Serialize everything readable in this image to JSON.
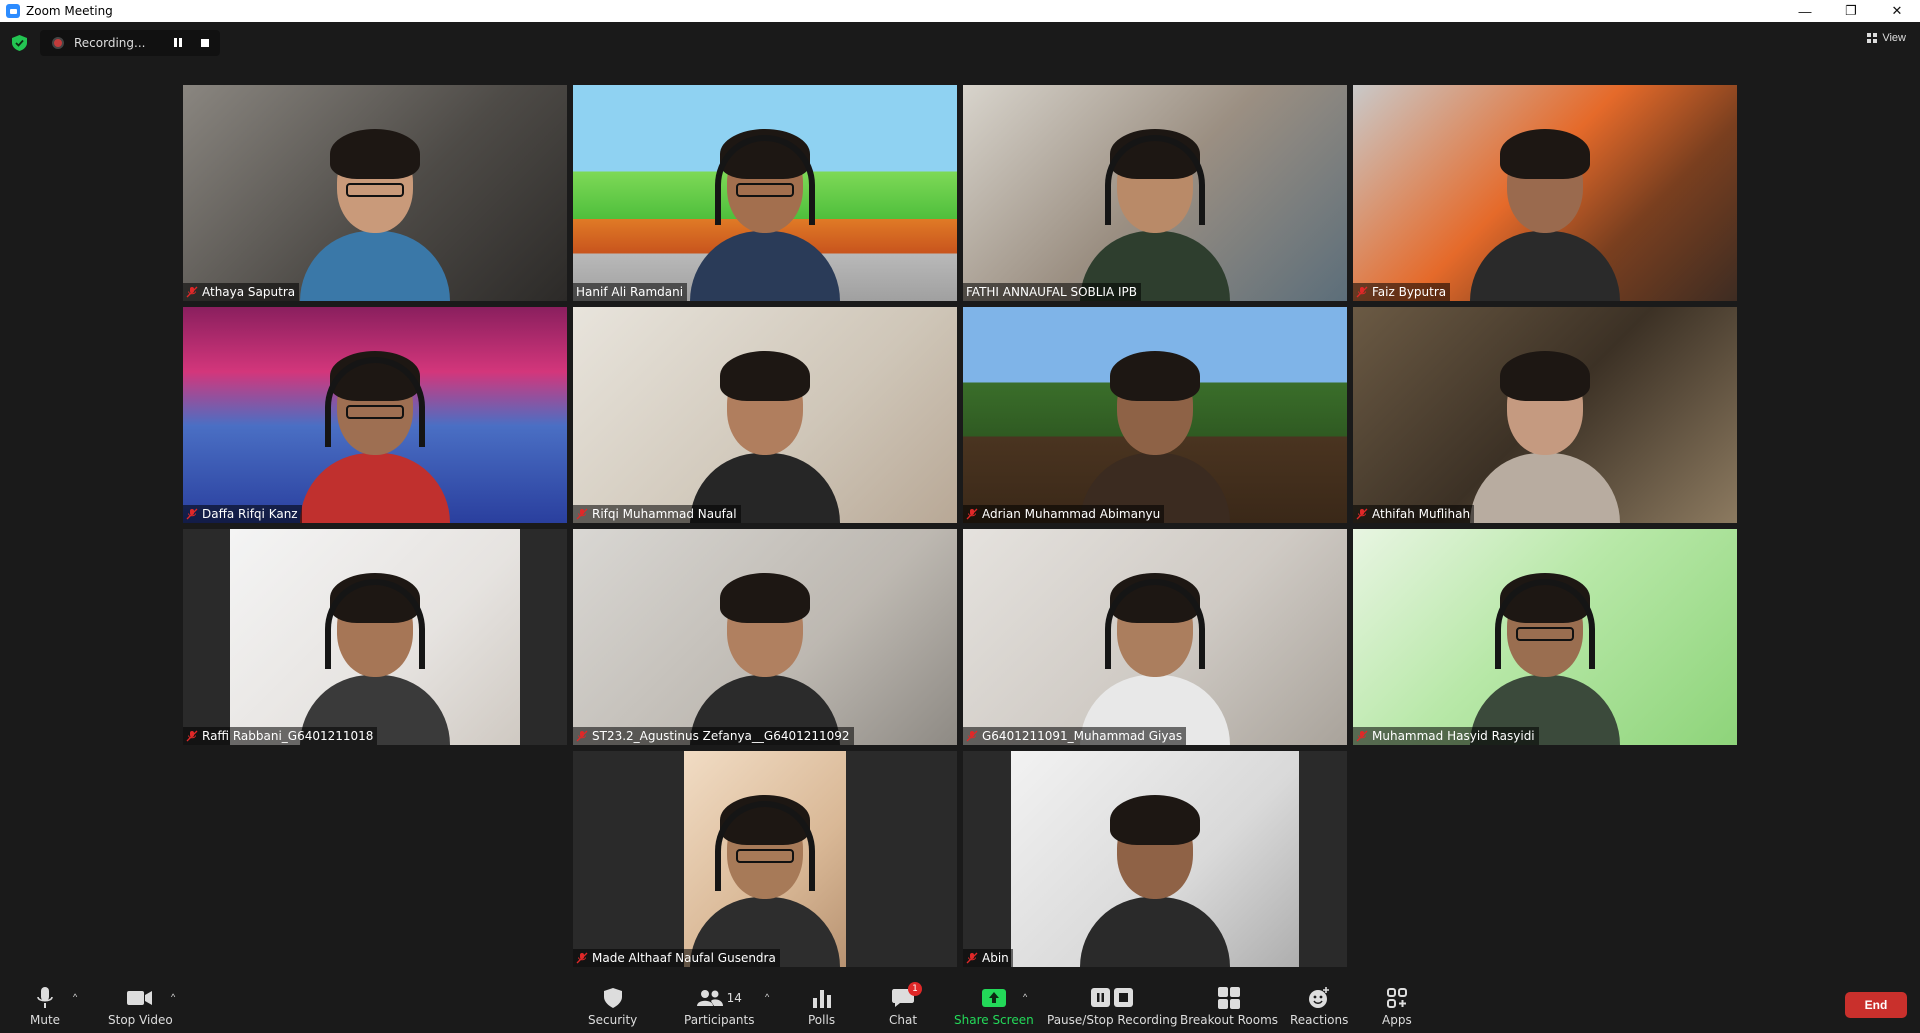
{
  "window": {
    "title": "Zoom Meeting",
    "minimize": "—",
    "restore": "❐",
    "close": "✕"
  },
  "top_bar": {
    "recording_label": "Recording...",
    "view_label": "View"
  },
  "participants_tiles": [
    {
      "name": "Athaya Saputra",
      "muted": true,
      "active": false
    },
    {
      "name": "Hanif Ali Ramdani",
      "muted": false,
      "active": true
    },
    {
      "name": "FATHI ANNAUFAL SOBLIA IPB",
      "muted": false,
      "active": false
    },
    {
      "name": "Faiz Byputra",
      "muted": true,
      "active": false
    },
    {
      "name": "Daffa Rifqi Kanz",
      "muted": true,
      "active": false
    },
    {
      "name": "Rifqi Muhammad Naufal",
      "muted": true,
      "active": false
    },
    {
      "name": "Adrian Muhammad Abimanyu",
      "muted": true,
      "active": false
    },
    {
      "name": "Athifah Muflihah",
      "muted": true,
      "active": false
    },
    {
      "name": "Raffi Rabbani_G6401211018",
      "muted": true,
      "active": false
    },
    {
      "name": "ST23.2_Agustinus Zefanya__G6401211092",
      "muted": true,
      "active": false
    },
    {
      "name": "G6401211091_Muhammad Giyas",
      "muted": true,
      "active": false
    },
    {
      "name": "Muhammad Hasyid Rasyidi",
      "muted": true,
      "active": false
    },
    {
      "name": "Made Althaaf Naufal Gusendra",
      "muted": true,
      "active": false
    },
    {
      "name": "Abin",
      "muted": true,
      "active": false
    }
  ],
  "toolbar": {
    "mute_label": "Mute",
    "stop_video_label": "Stop Video",
    "security_label": "Security",
    "participants_label": "Participants",
    "participants_count": "14",
    "polls_label": "Polls",
    "chat_label": "Chat",
    "chat_badge": "1",
    "share_screen_label": "Share Screen",
    "pause_stop_recording_label": "Pause/Stop Recording",
    "breakout_rooms_label": "Breakout Rooms",
    "reactions_label": "Reactions",
    "apps_label": "Apps",
    "end_label": "End"
  },
  "colors": {
    "active_speaker_border": "#e7e26a",
    "end_button": "#c9302c",
    "share_screen": "#23d959",
    "mic_off": "#e02828"
  },
  "icons": [
    "shield-icon",
    "record-icon",
    "pause-icon",
    "stop-icon",
    "view-grid-icon",
    "mic-off-icon",
    "microphone-icon",
    "video-camera-icon",
    "security-shield-icon",
    "participants-icon",
    "polls-icon",
    "chat-icon",
    "share-screen-icon",
    "pause-stop-recording-icon",
    "breakout-rooms-icon",
    "reactions-icon",
    "apps-icon"
  ]
}
